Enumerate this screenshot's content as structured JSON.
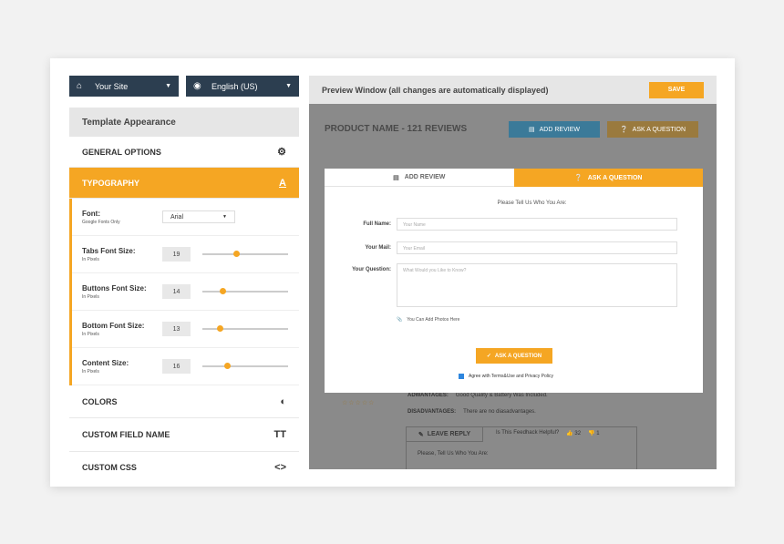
{
  "selectors": {
    "site": {
      "label": "Your Site",
      "icon": "home-icon"
    },
    "language": {
      "label": "English (US)",
      "icon": "gamepad-icon"
    }
  },
  "sidebar": {
    "header": "Template Appearance",
    "general_options": "GENERAL OPTIONS",
    "typography": "TYPOGRAPHY",
    "font": {
      "label": "Font:",
      "sub": "Google Fonts Only",
      "value": "Arial"
    },
    "settings": [
      {
        "label": "Tabs Font Size:",
        "sub": "In Pixels",
        "value": "19",
        "slider": 0.36
      },
      {
        "label": "Buttons Font Size:",
        "sub": "In Pixels",
        "value": "14",
        "slider": 0.2
      },
      {
        "label": "Bottom Font Size:",
        "sub": "In Pixels",
        "value": "13",
        "slider": 0.17
      },
      {
        "label": "Content Size:",
        "sub": "In Pixels",
        "value": "16",
        "slider": 0.25
      }
    ],
    "colors": "COLORS",
    "custom_field_name": "CUSTOM FIELD NAME",
    "custom_css": "CUSTOM CSS"
  },
  "preview": {
    "header": "Preview Window (all changes are automatically displayed)",
    "save": "SAVE",
    "product_title": "PRODUCT NAME - 121 REVIEWS",
    "add_review": "ADD REVIEW",
    "ask_question": "ASK A QUESTION",
    "advantages_label": "ADWANTAGES:",
    "advantages": "Good Quality & Battery Was Included.",
    "disadvantages_label": "DISADVANTAGES:",
    "disadvantages": "There are no diasadvantages.",
    "leave_reply": "LEAVE REPLY",
    "helpful": "Is This Feedhack Helpful?",
    "up_count": "32",
    "down_count": "1",
    "reply_text": "Please, Tell Us Who You Are:"
  },
  "modal": {
    "tab_add": "ADD REVIEW",
    "tab_ask": "ASK A QUESTION",
    "intro": "Please Tell Us Who You Are:",
    "full_name_label": "Full Name:",
    "full_name_placeholder": "Your Name",
    "mail_label": "Your Mail:",
    "mail_placeholder": "Your Email",
    "question_label": "Your Question:",
    "question_placeholder": "What Would you Like to Know?",
    "attach": "You Can Add Photos Here",
    "submit": "ASK A QUESTION",
    "agree": "Agree with Terms&Use and Privacy Policy"
  },
  "colors": {
    "accent": "#f5a623",
    "dark": "#2c3e50"
  }
}
